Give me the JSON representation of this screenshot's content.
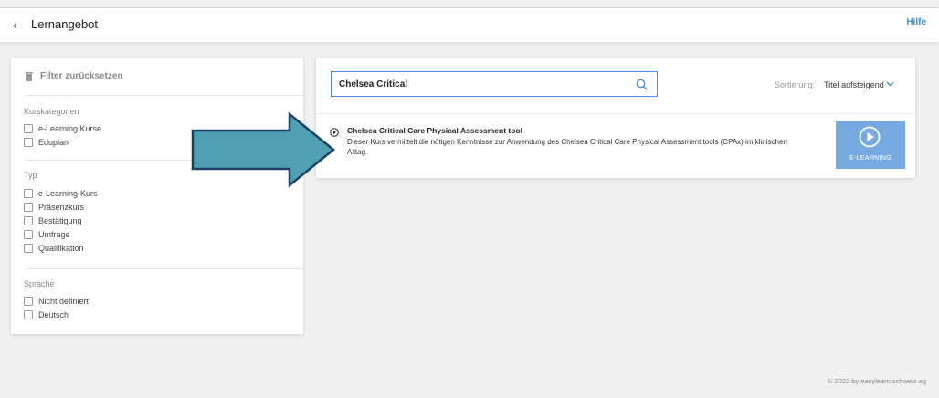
{
  "header": {
    "back_icon": "chevron-left-icon",
    "title": "Lernangebot",
    "help": "Hilfe"
  },
  "filter": {
    "reset_icon": "trash-icon",
    "reset_label": "Filter zurücksetzen",
    "groups": [
      {
        "title": "Kurskategorien",
        "items": [
          "e-Learning Kurse",
          "Eduplan"
        ]
      },
      {
        "title": "Typ",
        "items": [
          "e-Learning-Kurs",
          "Präsenzkurs",
          "Bestätigung",
          "Umfrage",
          "Qualifikation"
        ]
      },
      {
        "title": "Sprache",
        "items": [
          "Nicht definiert",
          "Deutsch"
        ]
      }
    ]
  },
  "search": {
    "value": "Chelsea Critical",
    "icon": "search-icon"
  },
  "sort": {
    "label": "Sortierung:",
    "value": "Titel aufsteigend"
  },
  "result": {
    "title": "Chelsea Critical Care Physical Assessment tool",
    "description": "Dieser Kurs vermittelt die nötigen Kenntnisse zur Anwendung des Chelsea Critical Care Physical Assessment tools (CPAx) im klinischen Alltag.",
    "type_label": "E-LEARNING"
  },
  "footer": "© 2022 by easylearn schweiz ag",
  "colors": {
    "accent": "#3b8ed8",
    "tile": "#76a9df",
    "arrow_fill": "#4fa0b0",
    "arrow_stroke": "#1e3f66"
  }
}
